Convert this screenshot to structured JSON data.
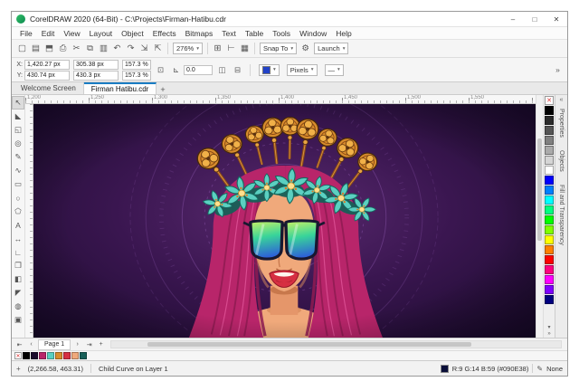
{
  "window": {
    "title": "CorelDRAW 2020 (64-Bit) - C:\\Projects\\Firman-Hatibu.cdr",
    "minimize": "–",
    "maximize": "□",
    "close": "✕"
  },
  "menu_items": [
    "File",
    "Edit",
    "View",
    "Layout",
    "Object",
    "Effects",
    "Bitmaps",
    "Text",
    "Table",
    "Tools",
    "Window",
    "Help"
  ],
  "standard_toolbar": {
    "icons": [
      {
        "name": "new-document-icon",
        "glyph": "▢"
      },
      {
        "name": "open-icon",
        "glyph": "▤"
      },
      {
        "name": "save-icon",
        "glyph": "⬒"
      },
      {
        "name": "print-icon",
        "glyph": "⎙"
      },
      {
        "name": "cut-icon",
        "glyph": "✂"
      },
      {
        "name": "copy-icon",
        "glyph": "⧉"
      },
      {
        "name": "paste-icon",
        "glyph": "▥"
      },
      {
        "name": "undo-icon",
        "glyph": "↶"
      },
      {
        "name": "redo-icon",
        "glyph": "↷"
      },
      {
        "name": "import-icon",
        "glyph": "⇲"
      },
      {
        "name": "export-icon",
        "glyph": "⇱"
      }
    ],
    "zoom_level": "276%",
    "extra_icons": [
      {
        "name": "fullscreen-preview-icon",
        "glyph": "⊞"
      },
      {
        "name": "show-rulers-icon",
        "glyph": "⊢"
      },
      {
        "name": "show-grid-icon",
        "glyph": "▦"
      }
    ],
    "snap_to_label": "Snap To",
    "options_icon": "⚙",
    "launch_label": "Launch"
  },
  "property_bar": {
    "x_label": "X:",
    "x_value": "1,420.27 px",
    "y_label": "Y:",
    "y_value": "430.74 px",
    "width_value": "305.38 px",
    "height_value": "430.3 px",
    "width_scale": "157.3 %",
    "height_scale": "157.3 %",
    "lock_icon": "⊡",
    "angle_icon": "⊾",
    "angle_value": "0.0",
    "mirror_h_icon": "◫",
    "mirror_v_icon": "⊟",
    "swatch": "#2242c8",
    "units_value": "Pixels",
    "line_style": "—",
    "more_icon": "»"
  },
  "document_tabs": [
    {
      "label": "Welcome Screen"
    },
    {
      "label": "Firman Hatibu.cdr",
      "active": true
    }
  ],
  "tab_add_icon": "+",
  "ruler_numbers": [
    "1,200",
    "1,250",
    "1,300",
    "1,350",
    "1,400",
    "1,450",
    "1,500",
    "1,550"
  ],
  "toolbox_tools": [
    {
      "name": "pick-tool",
      "glyph": "↖"
    },
    {
      "name": "shape-tool",
      "glyph": "◣"
    },
    {
      "name": "crop-tool",
      "glyph": "◱"
    },
    {
      "name": "zoom-tool",
      "glyph": "◎"
    },
    {
      "name": "freehand-tool",
      "glyph": "✎"
    },
    {
      "name": "artistic-media-tool",
      "glyph": "∿"
    },
    {
      "name": "rectangle-tool",
      "glyph": "▭"
    },
    {
      "name": "ellipse-tool",
      "glyph": "○"
    },
    {
      "name": "polygon-tool",
      "glyph": "⬠"
    },
    {
      "name": "text-tool",
      "glyph": "A"
    },
    {
      "name": "dimension-tool",
      "glyph": "↔"
    },
    {
      "name": "connector-tool",
      "glyph": "∟"
    },
    {
      "name": "shadow-tool",
      "glyph": "❐"
    },
    {
      "name": "transparency-tool",
      "glyph": "◧"
    },
    {
      "name": "eyedropper-tool",
      "glyph": "◤"
    },
    {
      "name": "interactive-fill-tool",
      "glyph": "◍"
    },
    {
      "name": "smart-fill-tool",
      "glyph": "▣"
    }
  ],
  "palette_no_color": "✕",
  "color_palette": [
    "#000000",
    "#2b2b2b",
    "#555555",
    "#808080",
    "#aaaaaa",
    "#d5d5d5",
    "#ffffff",
    "#0000ff",
    "#0080ff",
    "#00ffff",
    "#00ff80",
    "#00ff00",
    "#80ff00",
    "#ffff00",
    "#ff8000",
    "#ff0000",
    "#ff0080",
    "#ff00ff",
    "#8000ff",
    "#000080"
  ],
  "palette_nav_down": "▾",
  "palette_nav_more": "»",
  "docker_collapse_icon": "«",
  "dockers": [
    "Properties",
    "Objects",
    "Fill and Transparency"
  ],
  "page_nav": {
    "first": "⇤",
    "prev": "‹",
    "label": "Page 1",
    "next": "›",
    "last": "⇥",
    "add": "+"
  },
  "document_palette": [
    "#000000",
    "#1a0a2c",
    "#b8256a",
    "#58cfc0",
    "#d88c2c",
    "#d62f42",
    "#f0a97b",
    "#175f58"
  ],
  "status_bar": {
    "cursor_icon": "+",
    "cursor_pos": "(2,266.58, 463.31)",
    "selection_info": "Child Curve on Layer 1",
    "fill_swatch": "#090E38",
    "fill_text": "R:9 G:14 B:59 (#090E38)",
    "outline_icon": "✎",
    "outline_value": "None"
  },
  "artwork": {
    "background_color": "#1a0a2c",
    "mandala_color": "#b678de",
    "hair_color": "#b8256a",
    "flower_color": "#5bd0c1",
    "ornament_color": "#d88c2c",
    "skin_color": "#f0a97b",
    "lip_color": "#d62f42",
    "lens_top": "#cdf263",
    "lens_bottom": "#2e62d8"
  }
}
